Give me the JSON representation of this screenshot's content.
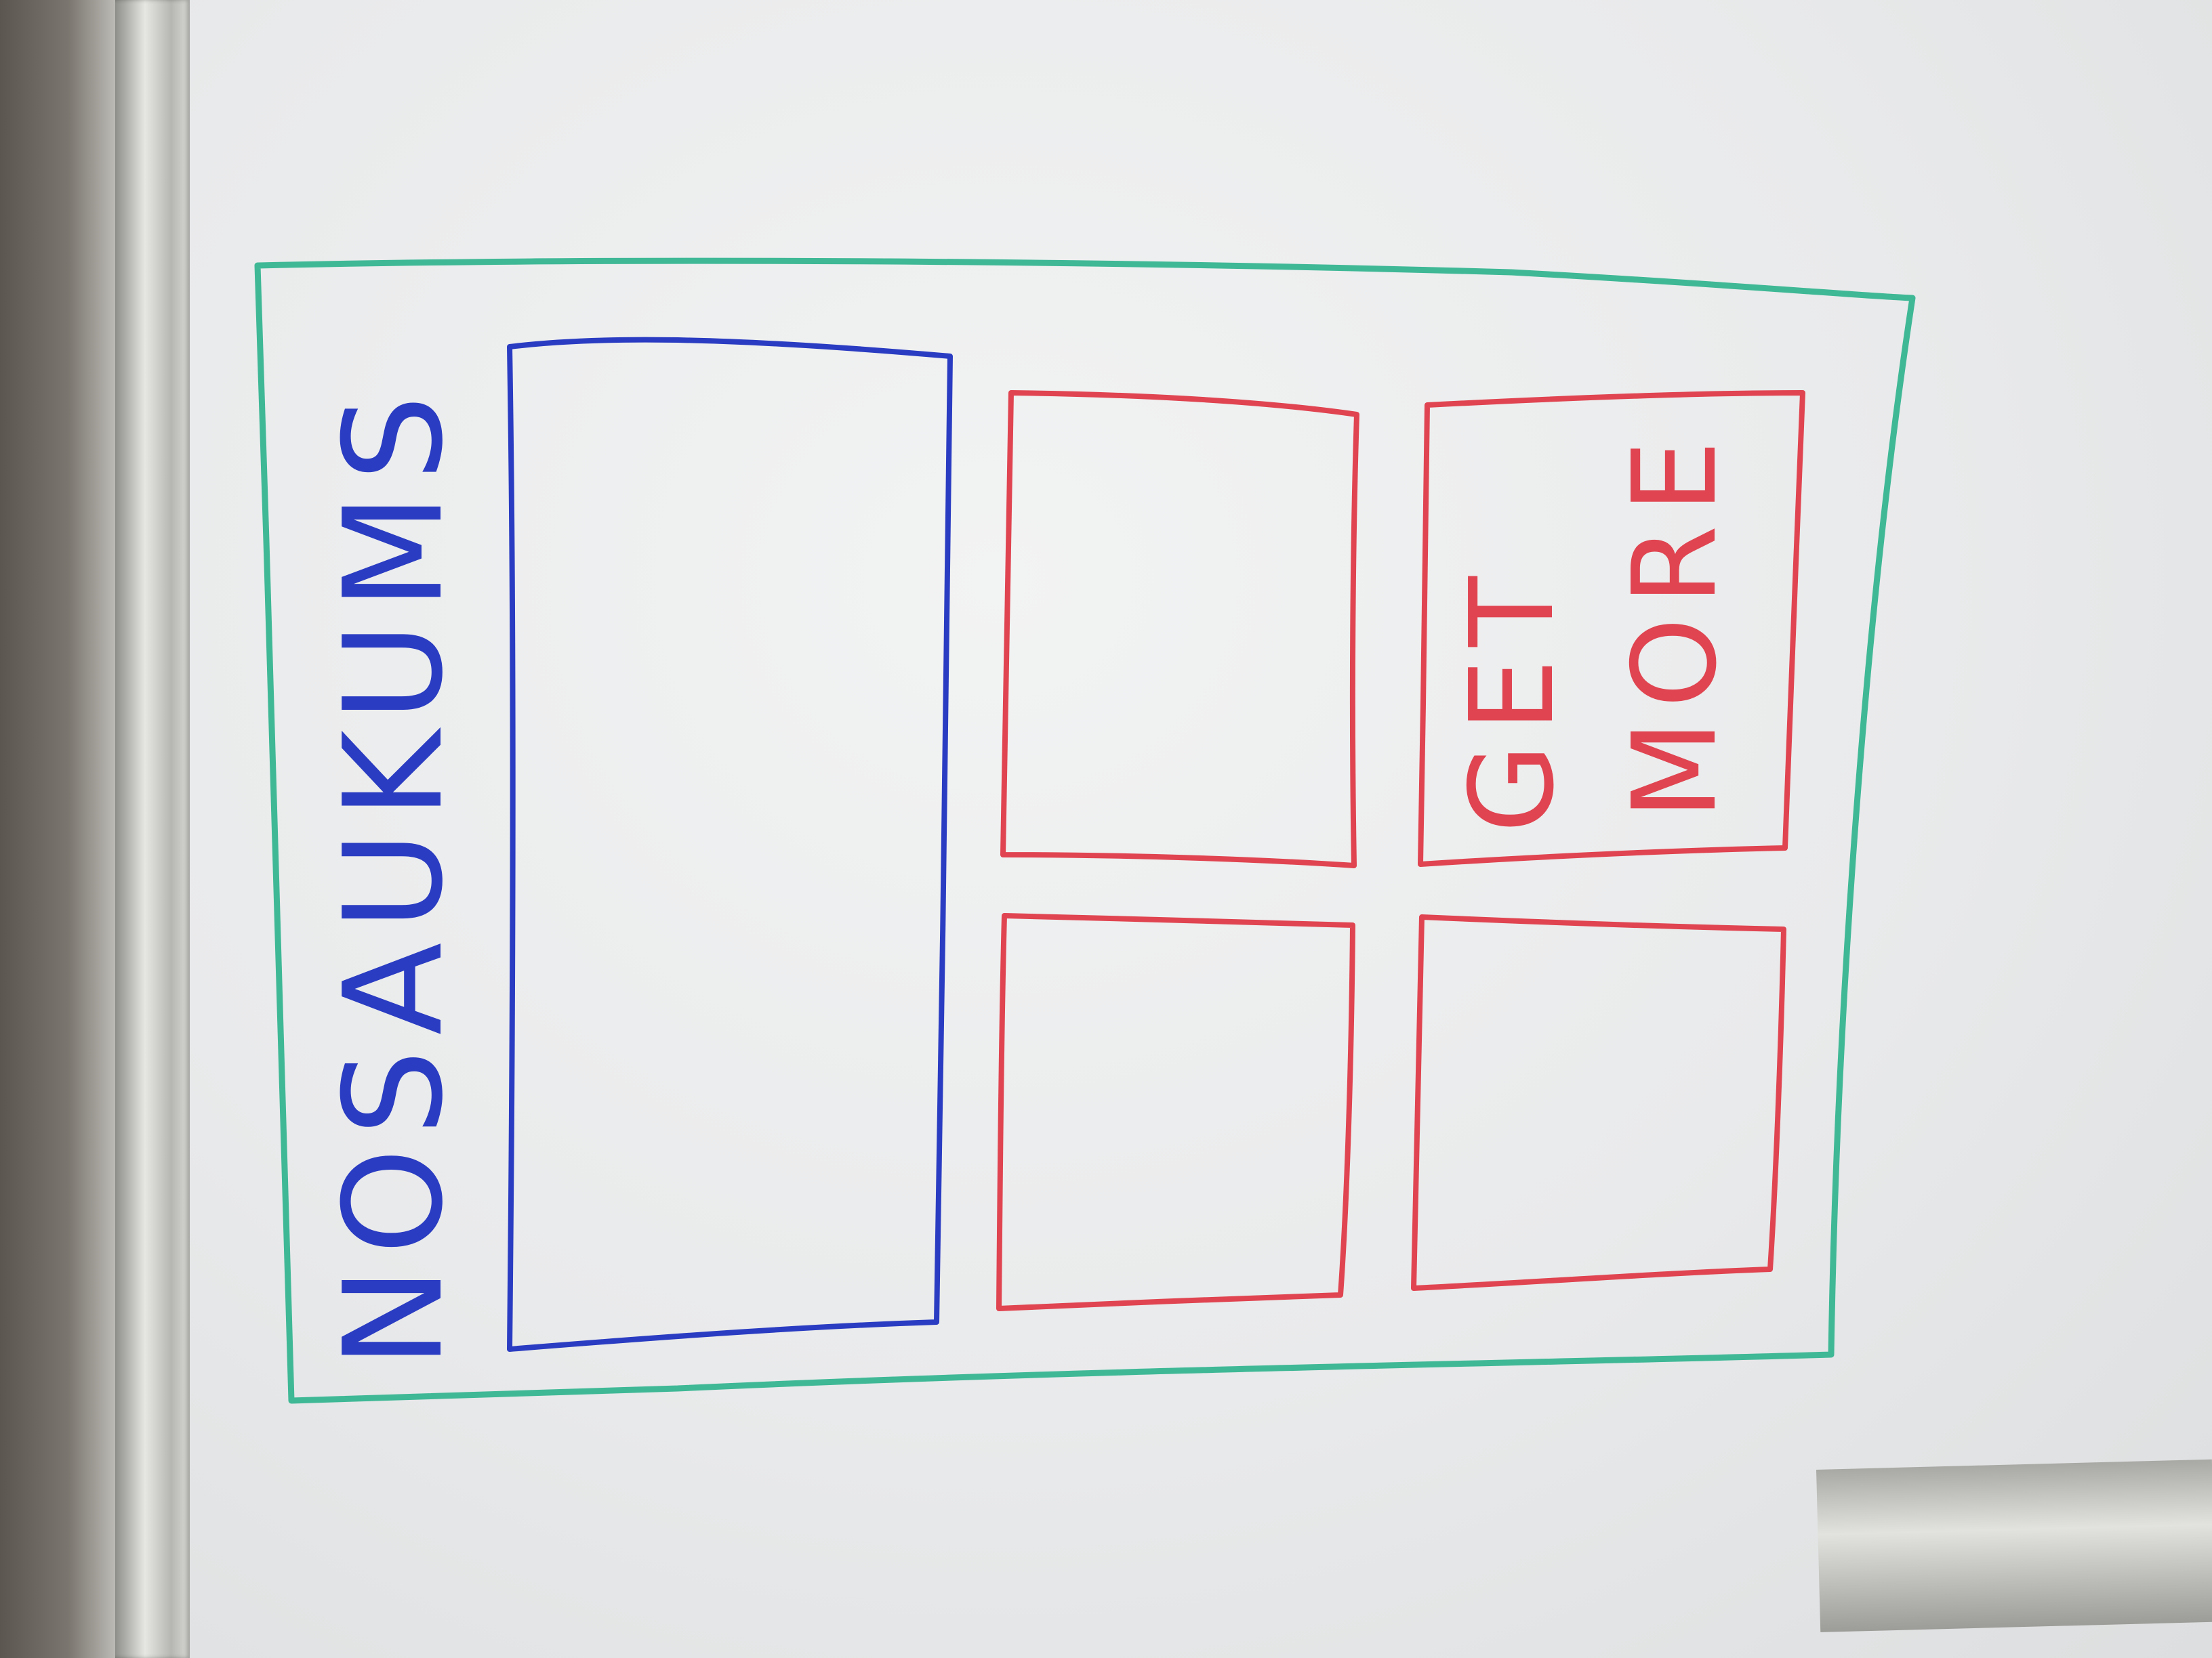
{
  "sketch": {
    "header_text": "NOSAUKUMS",
    "button_text_line1": "GET",
    "button_text_line2": "MORE"
  },
  "colors": {
    "outer_frame": "#3fb896",
    "hero_box": "#2a3cc2",
    "tiles": "#e04450",
    "board": "#eceded"
  }
}
